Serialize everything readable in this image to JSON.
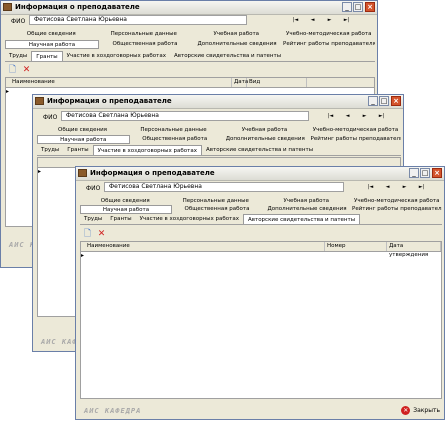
{
  "window_title": "Информация о преподавателе",
  "fio_label": "ФИО",
  "fio_value": "Фетисова Светлана Юрьевна",
  "nav": {
    "first": "|◄",
    "prev": "◄",
    "next": "►",
    "last": "►|"
  },
  "tabs_row1": [
    "Общие сведения",
    "Персональные данные",
    "Учебная работа",
    "Учебно-методическая работа"
  ],
  "tabs_row2": [
    "Научная работа",
    "Общественная работа",
    "Дополнительные сведения",
    "Рейтинг работы преподавателя"
  ],
  "subtabs": [
    "Труды",
    "Гранты",
    "Участие в хоздоговорных работах",
    "Авторские свидетельства и патенты"
  ],
  "win1_columns": [
    "Наименование",
    "Дата",
    "Вид"
  ],
  "win3_columns": [
    "Наименование",
    "Номер",
    "Дата утверждения"
  ],
  "brand": "АИС КАФЕДРА",
  "close_label": "Закрыть"
}
